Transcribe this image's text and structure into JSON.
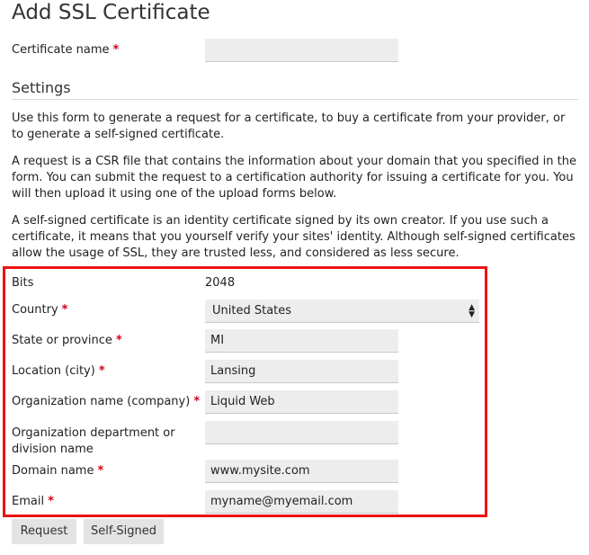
{
  "page": {
    "title": "Add SSL Certificate"
  },
  "certificate_name": {
    "label": "Certificate name",
    "required_mark": "*",
    "value": ""
  },
  "settings": {
    "heading": "Settings",
    "paragraphs": [
      "Use this form to generate a request for a certificate, to buy a certificate from your provider, or to generate a self-signed certificate.",
      "A request is a CSR file that contains the information about your domain that you specified in the form. You can submit the request to a certification authority for issuing a certificate for you. You will then upload it using one of the upload forms below.",
      "A self-signed certificate is an identity certificate signed by its own creator. If you use such a certificate, it means that you yourself verify your sites' identity. Although self-signed certificates allow the usage of SSL, they are trusted less, and considered as less secure."
    ]
  },
  "form": {
    "bits": {
      "label": "Bits",
      "value": "2048"
    },
    "country": {
      "label": "Country",
      "required_mark": "*",
      "value": "United States"
    },
    "state": {
      "label": "State or province",
      "required_mark": "*",
      "value": "MI"
    },
    "location": {
      "label": "Location (city)",
      "required_mark": "*",
      "value": "Lansing"
    },
    "organization": {
      "label": "Organization name (company)",
      "required_mark": "*",
      "value": "Liquid Web"
    },
    "department": {
      "label_line1": "Organization department or",
      "label_line2": "division name",
      "value": ""
    },
    "domain": {
      "label": "Domain name",
      "required_mark": "*",
      "value": "www.mysite.com"
    },
    "email": {
      "label": "Email",
      "required_mark": "*",
      "value": "myname@myemail.com"
    }
  },
  "buttons": {
    "request": "Request",
    "self_signed": "Self-Signed"
  },
  "colors": {
    "highlight_border": "#ee1111",
    "required": "#d0021b",
    "field_bg": "#ededed",
    "button_bg": "#e3e3e3"
  },
  "icons": {
    "country_select": "updown-arrows-icon"
  }
}
